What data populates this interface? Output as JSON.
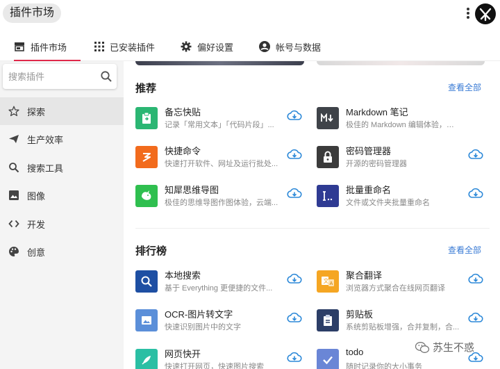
{
  "app": {
    "title": "插件市场"
  },
  "tabs": [
    {
      "label": "插件市场",
      "icon": "store-icon"
    },
    {
      "label": "已安装插件",
      "icon": "grid-icon"
    },
    {
      "label": "偏好设置",
      "icon": "gear-icon"
    },
    {
      "label": "帐号与数据",
      "icon": "account-icon"
    }
  ],
  "sidebar": {
    "search_placeholder": "搜索插件",
    "items": [
      {
        "label": "探索",
        "icon": "star-icon"
      },
      {
        "label": "生产效率",
        "icon": "send-icon"
      },
      {
        "label": "搜索工具",
        "icon": "search-icon"
      },
      {
        "label": "图像",
        "icon": "image-icon"
      },
      {
        "label": "开发",
        "icon": "code-icon"
      },
      {
        "label": "创意",
        "icon": "palette-icon"
      }
    ]
  },
  "sections": {
    "recommend": {
      "title": "推荐",
      "see_all": "查看全部",
      "items": [
        {
          "name": "备忘快贴",
          "desc": "记录「常用文本」「代码片段」...",
          "icon": "clipboard-paste-icon",
          "color": "#2bb673"
        },
        {
          "name": "Markdown 笔记",
          "desc": "极佳的 Markdown 编辑体验，实时...",
          "icon": "markdown-icon",
          "color": "#3f4349"
        },
        {
          "name": "快捷命令",
          "desc": "快速打开软件、网址及运行批处...",
          "icon": "lightning-icon",
          "color": "#f26b1d"
        },
        {
          "name": "密码管理器",
          "desc": "开源的密码管理器",
          "icon": "lock-icon",
          "color": "#3b3b3b"
        },
        {
          "name": "知犀思维导图",
          "desc": "极佳的思维导图作图体验，云端...",
          "icon": "rhino-icon",
          "color": "#2fbf4f"
        },
        {
          "name": "批量重命名",
          "desc": "文件或文件夹批量重命名",
          "icon": "rename-icon",
          "color": "#2f3b93"
        }
      ]
    },
    "ranking": {
      "title": "排行榜",
      "see_all": "查看全部",
      "items": [
        {
          "name": "本地搜索",
          "desc": "基于 Everything 更便捷的文件...",
          "icon": "magnifier-icon",
          "color": "#1e4fa3"
        },
        {
          "name": "聚合翻译",
          "desc": "浏览器方式聚合在线网页翻译",
          "icon": "translate-icon",
          "color": "#f5a623"
        },
        {
          "name": "OCR-图片转文字",
          "desc": "快速识别图片中的文字",
          "icon": "ocr-image-icon",
          "color": "#5b8fd9"
        },
        {
          "name": "剪贴板",
          "desc": "系统剪贴板增强，合并复制，合...",
          "icon": "clipboard-icon",
          "color": "#2c3e67"
        },
        {
          "name": "网页快开",
          "desc": "快速打开网页，快速图片搜索",
          "icon": "rocket-icon",
          "color": "#2bbfa4"
        },
        {
          "name": "todo",
          "desc": "随时记录你的大小事务",
          "icon": "check-icon",
          "color": "#6a86d6"
        }
      ]
    }
  },
  "watermark": {
    "text": "苏生不惑"
  },
  "colors": {
    "accent": "#e0284a",
    "link": "#3a7bd5",
    "download": "#2b88d8"
  }
}
